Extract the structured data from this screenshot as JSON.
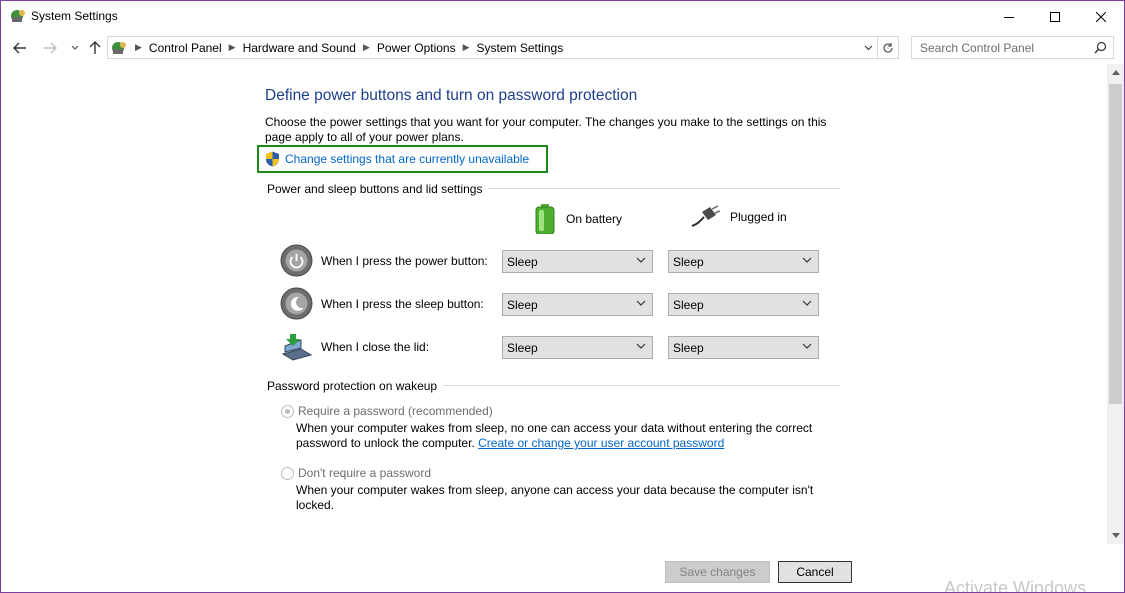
{
  "window": {
    "title": "System Settings",
    "controls": {
      "minimize": "minimize",
      "maximize": "maximize",
      "close": "close"
    }
  },
  "navigation": {
    "breadcrumbs": [
      "Control Panel",
      "Hardware and Sound",
      "Power Options",
      "System Settings"
    ],
    "search_placeholder": "Search Control Panel"
  },
  "main": {
    "heading": "Define power buttons and turn on password protection",
    "description": "Choose the power settings that you want for your computer. The changes you make to the settings on this page apply to all of your power plans.",
    "elevate_link": "Change settings that are currently unavailable",
    "buttons_group": {
      "title": "Power and sleep buttons and lid settings",
      "col_battery": "On battery",
      "col_plugged": "Plugged in",
      "rows": [
        {
          "label": "When I press the power button:",
          "battery": "Sleep",
          "plugged": "Sleep"
        },
        {
          "label": "When I press the sleep button:",
          "battery": "Sleep",
          "plugged": "Sleep"
        },
        {
          "label": "When I close the lid:",
          "battery": "Sleep",
          "plugged": "Sleep"
        }
      ]
    },
    "password_group": {
      "title": "Password protection on wakeup",
      "require_label": "Require a password (recommended)",
      "require_desc": "When your computer wakes from sleep, no one can access your data without entering the correct password to unlock the computer.",
      "require_link": "Create or change your user account password",
      "no_require_label": "Don't require a password",
      "no_require_desc": "When your computer wakes from sleep, anyone can access your data because the computer isn't locked.",
      "selected": "require"
    }
  },
  "footer": {
    "save_label": "Save changes",
    "cancel_label": "Cancel",
    "watermark": "Activate Windows"
  },
  "colors": {
    "heading": "#1e3f8c",
    "link": "#0066cc",
    "highlight_border": "#1b8a1b",
    "window_border": "#7a3fa0"
  }
}
